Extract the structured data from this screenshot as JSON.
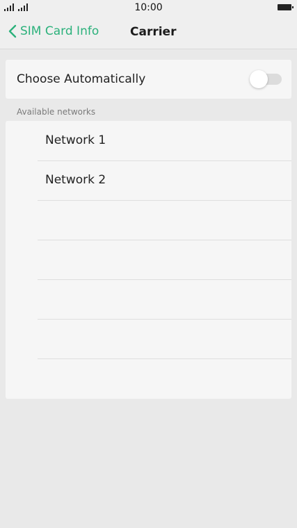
{
  "status_bar": {
    "time": "10:00"
  },
  "header": {
    "back_label": "SIM Card Info",
    "title": "Carrier"
  },
  "auto": {
    "label": "Choose Automatically",
    "enabled": false
  },
  "networks": {
    "section_label": "Available networks",
    "items": [
      {
        "label": "Network 1"
      },
      {
        "label": "Network 2"
      },
      {
        "label": ""
      },
      {
        "label": ""
      },
      {
        "label": ""
      },
      {
        "label": ""
      }
    ]
  },
  "colors": {
    "accent": "#2bb17b",
    "background": "#e9e9e9",
    "card": "#f6f6f6"
  }
}
